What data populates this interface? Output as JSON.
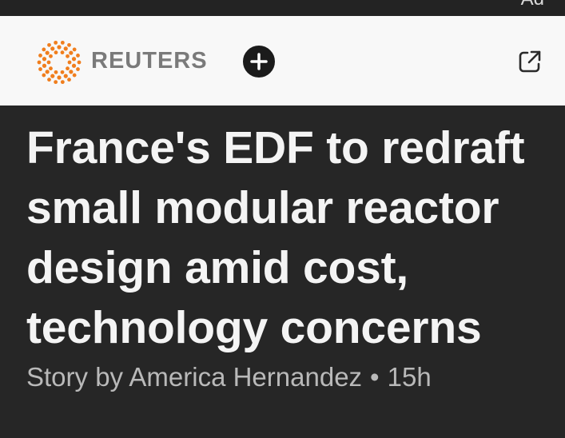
{
  "status_bar": {
    "ad_label": "Ad"
  },
  "header": {
    "publisher": "REUTERS",
    "follow_icon": "plus-icon",
    "open_icon": "open-external-icon",
    "logo_icon": "reuters-logo-icon",
    "colors": {
      "header_bg": "#f8f8f8",
      "logo_orange": "#f07e1d",
      "brand_gray": "#7a7a7a",
      "button_dark": "#1b1b1b"
    }
  },
  "article": {
    "headline": "France's EDF to redraft small modular reactor design amid cost, technology concerns",
    "byline_prefix": "Story by",
    "author": "America Hernandez",
    "separator": "•",
    "age": "15h",
    "colors": {
      "page_bg": "#262626",
      "headline": "#f4f4f4",
      "byline": "#b9b9b9"
    }
  }
}
